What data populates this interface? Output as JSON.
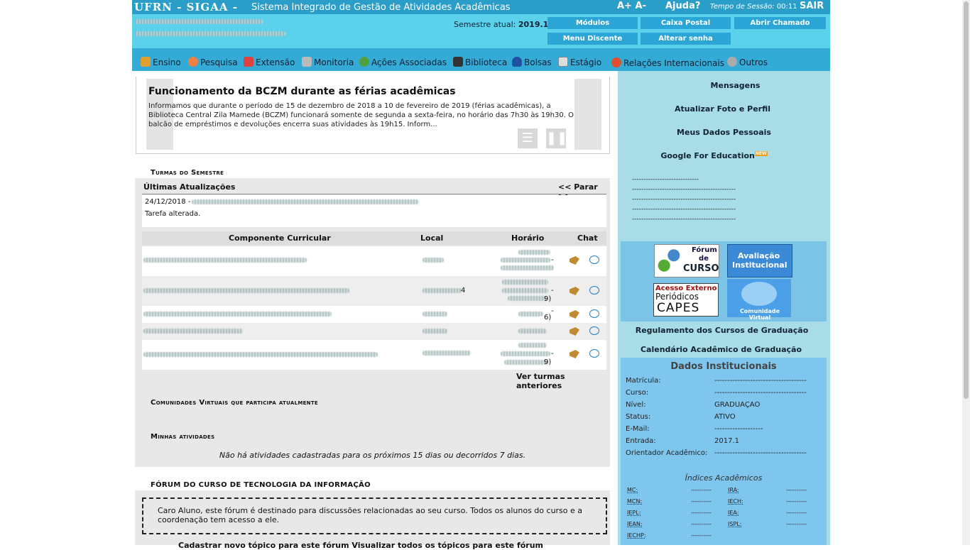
{
  "header": {
    "brand": "UFRN - SIGAA -",
    "system_title": "Sistema Integrado de Gestão de Atividades Acadêmicas",
    "font_size": "A+ A-",
    "help": "Ajuda?",
    "session_label": "Tempo de Sessão:",
    "session_time": "00:11",
    "logout": "SAIR",
    "semester_label": "Semestre atual:",
    "semester_value": "2019.1",
    "buttons": [
      "Módulos",
      "Caixa Postal",
      "Abrir Chamado",
      "Menu Discente",
      "Alterar senha"
    ]
  },
  "menu": {
    "items": [
      "Ensino",
      "Pesquisa",
      "Extensão",
      "Monitoria",
      "Ações Associadas",
      "Biblioteca",
      "Bolsas",
      "Estágio",
      "Relações Internacionais",
      "Outros"
    ]
  },
  "news": {
    "title": "Funcionamento da BCZM durante as férias acadêmicas",
    "text": "Informamos que durante o período de 15 de dezembro de 2018 a 10 de fevereiro de 2019 (férias acadêmicas), a Biblioteca Central Zila Mamede (BCZM) funcionará somente de segunda a sexta-feira, no horário das 7h30 às 19h30. O balcão de empréstimos e devoluções encerra suas atividades às 19h15. Inform..."
  },
  "turmas": {
    "section_title": "Turmas do Semestre",
    "updates_title": "Últimas Atualizações",
    "pager": "<< Parar >>",
    "update_date": "24/12/2018",
    "update_sep": "-",
    "update_text": "Tarefa alterada.",
    "columns": [
      "Componente Curricular",
      "Local",
      "Horário",
      "Chat"
    ],
    "row_partial": [
      "4",
      "-",
      "9)",
      "-",
      "6)",
      "-",
      "9)"
    ],
    "older": "Ver turmas anteriores"
  },
  "comunidades": {
    "section_title": "Comunidades Virtuais que participa atualmente"
  },
  "atividades": {
    "section_title": "Minhas atividades",
    "empty": "Não há atividades cadastradas para os próximos 15 dias ou decorridos 7 dias."
  },
  "forum": {
    "section_title": "FÓRUM DO CURSO DE TECNOLOGIA DA INFORMAÇÃO",
    "text": "Caro Aluno, este fórum é destinado para discussões relacionadas ao seu curso. Todos os alunos do curso e a coordenação tem acesso a ele.",
    "links": "Cadastrar novo tópico para este fórum   Visualizar todos os tópicos para este fórum"
  },
  "sidebar": {
    "links": [
      "Mensagens",
      "Atualizar Foto e Perfil",
      "Meus Dados Pessoais",
      "Google For Education"
    ],
    "new_badge": "NEW",
    "dashes": [
      "-----------------------------",
      "---------------------------------------------",
      "---------------------------------------------",
      "---------------------------------------------",
      "---------------------------------------------"
    ],
    "banners": {
      "forum": [
        "Fórum",
        "de",
        "CURSO"
      ],
      "avaliacao": [
        "Avaliação",
        "Institucional"
      ],
      "capes": [
        "Acesso Externo",
        "Periódicos",
        "CAPES"
      ],
      "comunidade": "Comunidade Virtual"
    },
    "regulamento": "Regulamento dos Cursos de Graduação",
    "calendario": "Calendário Acadêmico de Graduação"
  },
  "dados": {
    "title": "Dados Institucionais",
    "fields": [
      {
        "label": "Matrícula:",
        "value": "------------------------------------"
      },
      {
        "label": "Curso:",
        "value": "------------------------------------"
      },
      {
        "label": "Nível:",
        "value": "GRADUAÇÃO"
      },
      {
        "label": "Status:",
        "value": "ATIVO"
      },
      {
        "label": "E-Mail:",
        "value": "-------------------"
      },
      {
        "label": "Entrada:",
        "value": "2017.1"
      },
      {
        "label": "Orientador Acadêmico:",
        "value": "------------------------------------"
      }
    ],
    "indices_title": "Índices Acadêmicos",
    "indices": [
      {
        "label": "MC:",
        "value": "----------"
      },
      {
        "label": "IRA:",
        "value": "----------"
      },
      {
        "label": "MCN:",
        "value": "----------"
      },
      {
        "label": "IECH:",
        "value": "----------"
      },
      {
        "label": "IEPL:",
        "value": "----------"
      },
      {
        "label": "IEA:",
        "value": "----------"
      },
      {
        "label": "IEAN:",
        "value": "----------"
      },
      {
        "label": "ISPL:",
        "value": "----------"
      },
      {
        "label": "IECHP:",
        "value": "----------"
      }
    ]
  }
}
